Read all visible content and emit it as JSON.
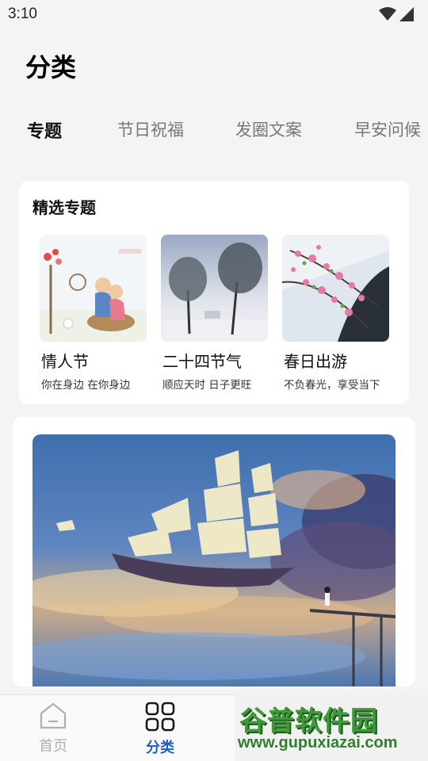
{
  "status_bar": {
    "time": "3:10"
  },
  "page": {
    "title": "分类"
  },
  "tabs": [
    {
      "label": "专题",
      "active": true
    },
    {
      "label": "节日祝福",
      "active": false
    },
    {
      "label": "发圈文案",
      "active": false
    },
    {
      "label": "早安问候",
      "active": false
    }
  ],
  "featured": {
    "title": "精选专题",
    "topics": [
      {
        "name": "情人节",
        "desc": "你在身边 在你身边"
      },
      {
        "name": "二十四节气",
        "desc": "顺应天时  日子更旺"
      },
      {
        "name": "春日出游",
        "desc": "不负春光，享受当下"
      }
    ]
  },
  "bottom_nav": {
    "home_label": "首页",
    "category_label": "分类"
  },
  "watermark": {
    "title": "谷普软件园",
    "url": "www.gupuxiazai.com"
  },
  "colors": {
    "accent": "#1f5fbf",
    "watermark_green": "#3f9b3a"
  }
}
